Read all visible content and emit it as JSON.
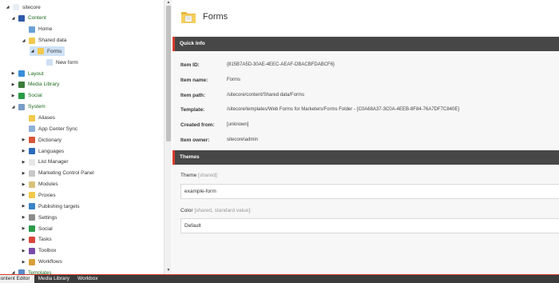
{
  "tree": {
    "items": [
      {
        "label": "sitecore",
        "arrow": "◢",
        "icon": "page-icon",
        "color": "#e8eef6",
        "green": false
      },
      {
        "label": "Content",
        "arrow": "◢",
        "icon": "content-icon",
        "color": "#2f5aa8",
        "green": true
      },
      {
        "label": "Home",
        "arrow": "",
        "icon": "home-icon",
        "color": "#6aa1d6",
        "green": false
      },
      {
        "label": "Shared data",
        "arrow": "◢",
        "icon": "folder-icon",
        "color": "#f2c94c",
        "green": false
      },
      {
        "label": "Forms",
        "arrow": "◢",
        "icon": "folder-icon",
        "color": "#f2c94c",
        "green": false,
        "selected": true
      },
      {
        "label": "New form",
        "arrow": "",
        "icon": "form-icon",
        "color": "#cfe0f5",
        "green": false
      },
      {
        "label": "Layout",
        "arrow": "▶",
        "icon": "layout-icon",
        "color": "#3a8ed8",
        "green": true
      },
      {
        "label": "Media Library",
        "arrow": "▶",
        "icon": "media-icon",
        "color": "#3d7b3a",
        "green": true
      },
      {
        "label": "Social",
        "arrow": "▶",
        "icon": "social-icon",
        "color": "#2b9b4a",
        "green": true
      },
      {
        "label": "System",
        "arrow": "◢",
        "icon": "system-icon",
        "color": "#7a9cc7",
        "green": true
      },
      {
        "label": "Aliases",
        "arrow": "",
        "icon": "folder-icon",
        "color": "#f2c94c",
        "green": false
      },
      {
        "label": "App Center Sync",
        "arrow": "",
        "icon": "sync-icon",
        "color": "#8fb0d8",
        "green": false
      },
      {
        "label": "Dictionary",
        "arrow": "▶",
        "icon": "dictionary-icon",
        "color": "#d8563a",
        "green": false
      },
      {
        "label": "Languages",
        "arrow": "▶",
        "icon": "languages-icon",
        "color": "#2a6ab8",
        "green": false
      },
      {
        "label": "List Manager",
        "arrow": "▶",
        "icon": "list-icon",
        "color": "#e6e6e6",
        "green": false
      },
      {
        "label": "Marketing Control Panel",
        "arrow": "▶",
        "icon": "marketing-icon",
        "color": "#c8c8c8",
        "green": false
      },
      {
        "label": "Modules",
        "arrow": "▶",
        "icon": "modules-icon",
        "color": "#d9c27a",
        "green": false
      },
      {
        "label": "Proxies",
        "arrow": "▶",
        "icon": "folder-icon",
        "color": "#f2c94c",
        "green": false
      },
      {
        "label": "Publishing targets",
        "arrow": "▶",
        "icon": "publishing-icon",
        "color": "#3b84c9",
        "green": false
      },
      {
        "label": "Settings",
        "arrow": "▶",
        "icon": "settings-icon",
        "color": "#8c8c8c",
        "green": false
      },
      {
        "label": "Social",
        "arrow": "▶",
        "icon": "social-icon",
        "color": "#2b9b4a",
        "green": false
      },
      {
        "label": "Tasks",
        "arrow": "▶",
        "icon": "tasks-icon",
        "color": "#d8453a",
        "green": false
      },
      {
        "label": "Toolbox",
        "arrow": "▶",
        "icon": "toolbox-icon",
        "color": "#7a4aa8",
        "green": false
      },
      {
        "label": "Workflows",
        "arrow": "▶",
        "icon": "workflows-icon",
        "color": "#d8a03a",
        "green": false
      },
      {
        "label": "Templates",
        "arrow": "◢",
        "icon": "templates-icon",
        "color": "#5a8ac8",
        "green": true
      }
    ]
  },
  "editor": {
    "title": "Forms",
    "quick_info": {
      "header": "Quick Info",
      "rows": [
        {
          "key": "Item ID:",
          "value": "{815B7A5D-30AE-4EEC-AEAF-DBACBFDABCF6}"
        },
        {
          "key": "Item name:",
          "value": "Forms"
        },
        {
          "key": "Item path:",
          "value": "/sitecore/content/Shared data/Forms"
        },
        {
          "key": "Template:",
          "value": "/sitecore/templates/Web Forms for Marketers/Forms Folder - {C0A68A37-3C0A-4EEB-8F84-76A7DF7C840E}"
        },
        {
          "key": "Created from:",
          "value": "[unknown]"
        },
        {
          "key": "Item owner:",
          "value": "sitecore\\admin"
        }
      ]
    },
    "themes": {
      "header": "Themes",
      "fields": [
        {
          "label": "Theme",
          "meta": " [shared]:",
          "value": "example-form"
        },
        {
          "label": "Color",
          "meta": " [shared, standard value]:",
          "value": "Default"
        }
      ]
    }
  },
  "bottom_tabs": [
    {
      "label": "Content Editor",
      "active": true
    },
    {
      "label": "Media Library",
      "active": false
    },
    {
      "label": "Workbox",
      "active": false
    }
  ],
  "colors": {
    "accent": "#d93a2b",
    "section_bar": "#474747",
    "selected": "#cfe2f6"
  }
}
